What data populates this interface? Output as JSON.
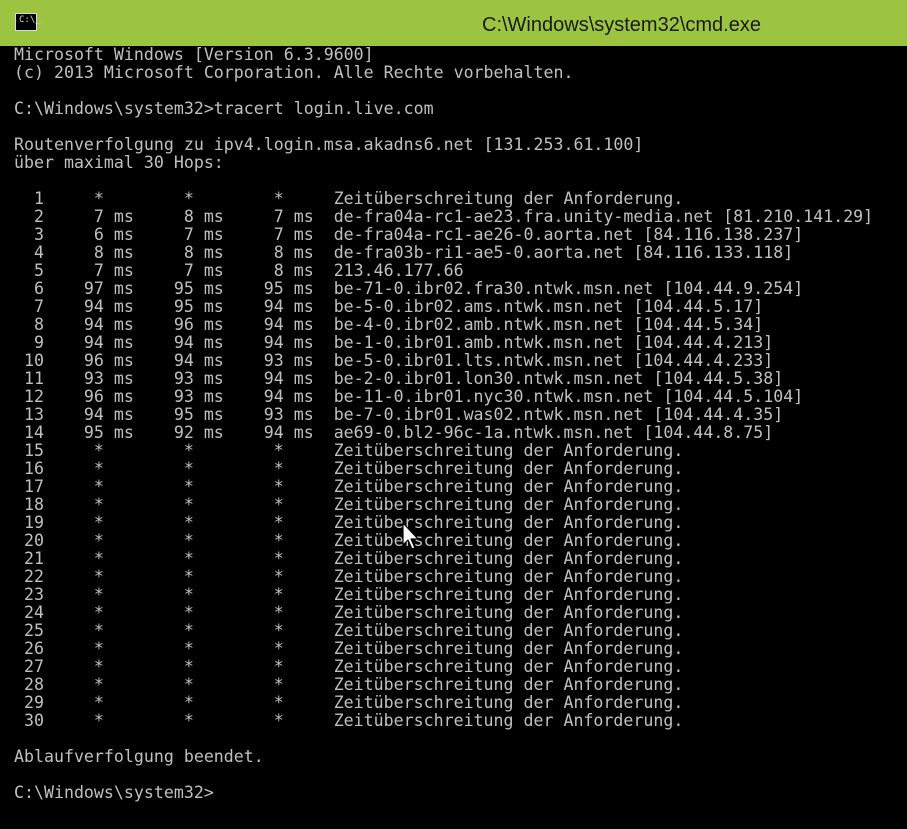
{
  "window": {
    "title": "C:\\Windows\\system32\\cmd.exe",
    "icon": "console-window-icon",
    "icon_glyph": "C:\\_",
    "colors": {
      "titlebar": "#9cc441",
      "console_background": "#000000",
      "console_text": "#c0c0c0"
    }
  },
  "console": {
    "lines": [
      "Microsoft Windows [Version 6.3.9600]",
      "(c) 2013 Microsoft Corporation. Alle Rechte vorbehalten.",
      "",
      "C:\\Windows\\system32>tracert login.live.com",
      "",
      "Routenverfolgung zu ipv4.login.msa.akadns6.net [131.253.61.100]",
      "über maximal 30 Hops:",
      "",
      "  1     *        *        *     Zeitüberschreitung der Anforderung.",
      "  2     7 ms     8 ms     7 ms  de-fra04a-rc1-ae23.fra.unity-media.net [81.210.141.29]",
      "  3     6 ms     7 ms     7 ms  de-fra04a-rc1-ae26-0.aorta.net [84.116.138.237]",
      "  4     8 ms     8 ms     8 ms  de-fra03b-ri1-ae5-0.aorta.net [84.116.133.118]",
      "  5     7 ms     7 ms     8 ms  213.46.177.66",
      "  6    97 ms    95 ms    95 ms  be-71-0.ibr02.fra30.ntwk.msn.net [104.44.9.254]",
      "  7    94 ms    95 ms    94 ms  be-5-0.ibr02.ams.ntwk.msn.net [104.44.5.17]",
      "  8    94 ms    96 ms    94 ms  be-4-0.ibr02.amb.ntwk.msn.net [104.44.5.34]",
      "  9    94 ms    94 ms    94 ms  be-1-0.ibr01.amb.ntwk.msn.net [104.44.4.213]",
      " 10    96 ms    94 ms    93 ms  be-5-0.ibr01.lts.ntwk.msn.net [104.44.4.233]",
      " 11    93 ms    93 ms    94 ms  be-2-0.ibr01.lon30.ntwk.msn.net [104.44.5.38]",
      " 12    96 ms    93 ms    94 ms  be-11-0.ibr01.nyc30.ntwk.msn.net [104.44.5.104]",
      " 13    94 ms    95 ms    93 ms  be-7-0.ibr01.was02.ntwk.msn.net [104.44.4.35]",
      " 14    95 ms    92 ms    94 ms  ae69-0.bl2-96c-1a.ntwk.msn.net [104.44.8.75]",
      " 15     *        *        *     Zeitüberschreitung der Anforderung.",
      " 16     *        *        *     Zeitüberschreitung der Anforderung.",
      " 17     *        *        *     Zeitüberschreitung der Anforderung.",
      " 18     *        *        *     Zeitüberschreitung der Anforderung.",
      " 19     *        *        *     Zeitüberschreitung der Anforderung.",
      " 20     *        *        *     Zeitüberschreitung der Anforderung.",
      " 21     *        *        *     Zeitüberschreitung der Anforderung.",
      " 22     *        *        *     Zeitüberschreitung der Anforderung.",
      " 23     *        *        *     Zeitüberschreitung der Anforderung.",
      " 24     *        *        *     Zeitüberschreitung der Anforderung.",
      " 25     *        *        *     Zeitüberschreitung der Anforderung.",
      " 26     *        *        *     Zeitüberschreitung der Anforderung.",
      " 27     *        *        *     Zeitüberschreitung der Anforderung.",
      " 28     *        *        *     Zeitüberschreitung der Anforderung.",
      " 29     *        *        *     Zeitüberschreitung der Anforderung.",
      " 30     *        *        *     Zeitüberschreitung der Anforderung.",
      "",
      "Ablaufverfolgung beendet.",
      "",
      "C:\\Windows\\system32>"
    ]
  },
  "mouse": {
    "icon": "mouse-pointer-icon"
  }
}
